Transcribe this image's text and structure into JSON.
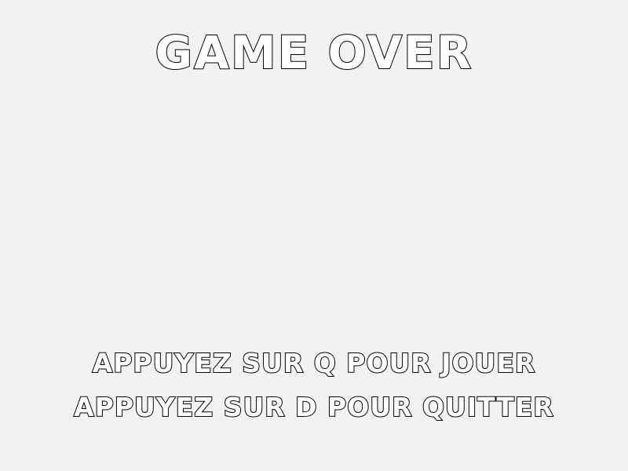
{
  "game_over": {
    "title": "GAME OVER",
    "instructions": {
      "play": "APPUYEZ SUR Q POUR JOUER",
      "quit": "APPUYEZ SUR D POUR QUITTER"
    }
  },
  "colors": {
    "background": "#f2f2f2",
    "text_fill": "#ffffff",
    "text_outline": "#000000"
  }
}
